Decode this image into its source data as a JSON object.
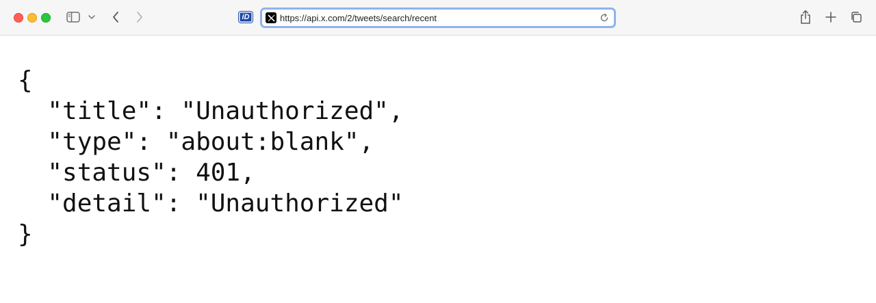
{
  "browser": {
    "url": "https://api.x.com/2/tweets/search/recent",
    "extension_label": "iD",
    "favicon_label": "X"
  },
  "icons": {
    "sidebar": "sidebar-icon",
    "sidebar_menu": "chevron-down-icon",
    "back": "chevron-left-icon",
    "forward": "chevron-right-icon",
    "reload": "reload-icon",
    "share": "share-icon",
    "new_tab": "plus-icon",
    "tab_overview": "tabs-icon"
  },
  "colors": {
    "address_focus": "#8fb2ee",
    "close": "#ff5f57",
    "minimize": "#febc2e",
    "zoom": "#28c840"
  },
  "response": {
    "text": "{\n  \"title\": \"Unauthorized\",\n  \"type\": \"about:blank\",\n  \"status\": 401,\n  \"detail\": \"Unauthorized\"\n}"
  }
}
